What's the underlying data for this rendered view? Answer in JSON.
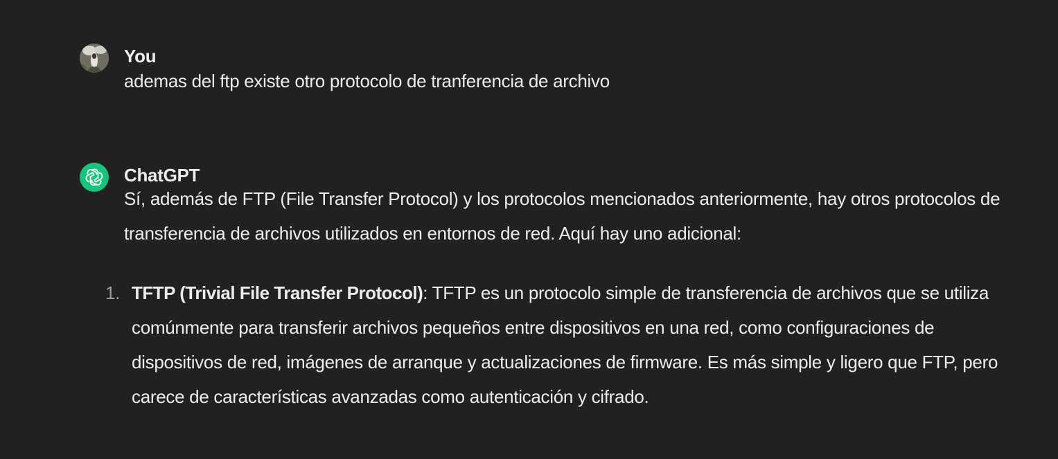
{
  "conversation": {
    "user": {
      "author": "You",
      "text": "ademas del ftp existe otro protocolo de tranferencia de archivo"
    },
    "assistant": {
      "author": "ChatGPT",
      "intro": "Sí, además de FTP (File Transfer Protocol) y los protocolos mencionados anteriormente, hay otros protocolos de transferencia de archivos utilizados en entornos de red. Aquí hay uno adicional:",
      "list": [
        {
          "marker": "1.",
          "term": "TFTP (Trivial File Transfer Protocol)",
          "separator": ":",
          "description": " TFTP es un protocolo simple de transferencia de archivos que se utiliza comúnmente para transferir archivos pequeños entre dispositivos en una red, como configuraciones de dispositivos de red, imágenes de arranque y actualizaciones de firmware. Es más simple y ligero que FTP, pero carece de características avanzadas como autenticación y cifrado."
        }
      ]
    }
  },
  "colors": {
    "background": "#212121",
    "text": "#ececec",
    "muted": "#9b9b9b",
    "gpt_accent": "#19c37d"
  },
  "icons": {
    "user_avatar": "user-avatar-photo",
    "assistant_avatar": "openai-logo-icon"
  }
}
